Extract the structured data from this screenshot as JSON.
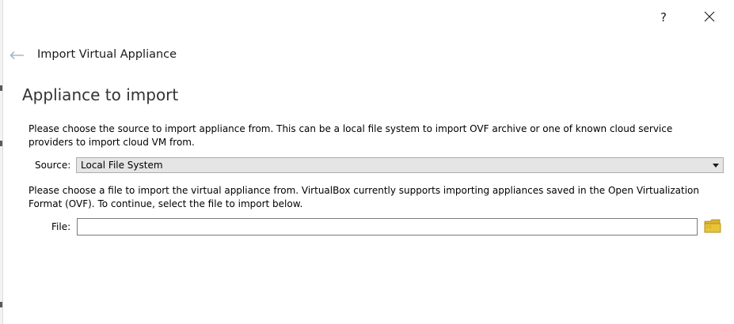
{
  "titlebar": {
    "help_label": "?",
    "close_icon": "close-icon"
  },
  "header": {
    "back_icon": "back-arrow-icon",
    "title": "Import Virtual Appliance"
  },
  "page": {
    "title": "Appliance to import",
    "intro": "Please choose the source to import appliance from. This can be a local file system to import OVF archive or one of known cloud service providers to import cloud VM from.",
    "source_label": "Source:",
    "source_value": "Local File System",
    "file_description": "Please choose a file to import the virtual appliance from. VirtualBox currently supports importing appliances saved in the Open Virtualization Format (OVF). To continue, select the file to import below.",
    "file_label": "File:",
    "file_value": "",
    "folder_icon": "folder-icon"
  },
  "colors": {
    "folder": "#e8c437",
    "select_bg": "#e5e5e5",
    "back_arrow": "#a9b7c6"
  }
}
